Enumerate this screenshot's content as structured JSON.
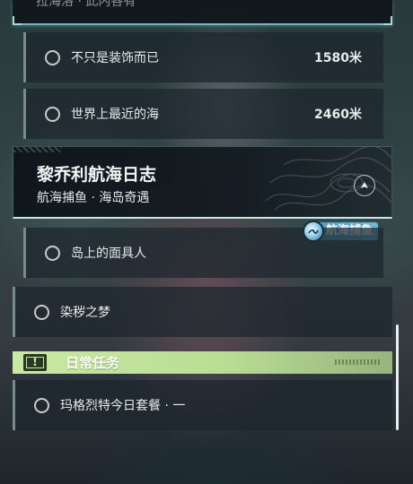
{
  "top_cut_text": "拉海洛 · 此内各有",
  "quests_upper": [
    {
      "label": "不只是装饰而已",
      "distance": "1580米"
    },
    {
      "label": "世界上最近的海",
      "distance": "2460米"
    }
  ],
  "event": {
    "title": "黎乔利航海日志",
    "subtitle": "航海捕鱼 · 海岛奇遇",
    "tag": "航海捕鱼",
    "pin_icon": "navigation-arrow-icon"
  },
  "quest_event_child": {
    "label": "岛上的面具人"
  },
  "quest_main": {
    "label": "染秽之梦"
  },
  "daily_section": {
    "title": "日常任务",
    "icon": "!"
  },
  "quest_daily": {
    "label": "玛格烈特今日套餐 · 一"
  },
  "colors": {
    "accent_line": "#7ab6bc",
    "daily_green": "#c9e8a4",
    "event_blue": "#4f9dc2"
  }
}
